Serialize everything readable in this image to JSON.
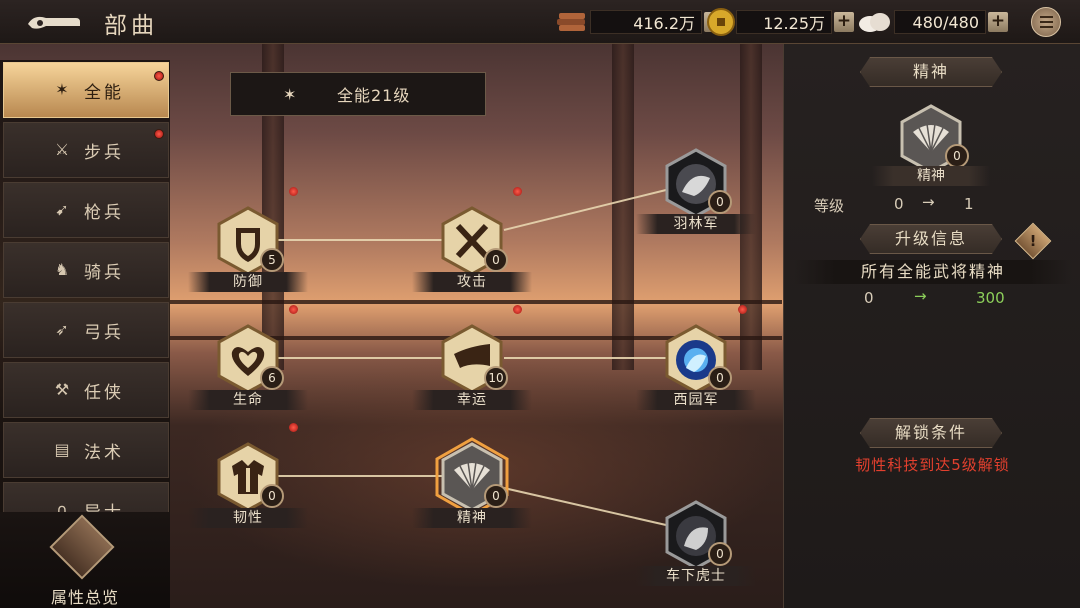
{
  "header": {
    "title": "部曲",
    "resources": [
      {
        "name": "supplies",
        "icon": "scroll-stack-icon",
        "value": "416.2万"
      },
      {
        "name": "coins",
        "icon": "gold-coin-icon",
        "value": "12.25万"
      },
      {
        "name": "stamina",
        "icon": "cloud-bun-icon",
        "value": "480/480"
      }
    ],
    "plus_label": "+"
  },
  "sidebar": {
    "tabs": [
      {
        "label": "全能",
        "icon": "all-round-icon",
        "active": true,
        "red_dot": true
      },
      {
        "label": "步兵",
        "icon": "sword-icon",
        "active": false,
        "red_dot": true
      },
      {
        "label": "枪兵",
        "icon": "spear-icon",
        "active": false,
        "red_dot": false
      },
      {
        "label": "骑兵",
        "icon": "horse-icon",
        "active": false,
        "red_dot": false
      },
      {
        "label": "弓兵",
        "icon": "bow-icon",
        "active": false,
        "red_dot": false
      },
      {
        "label": "任侠",
        "icon": "axe-icon",
        "active": false,
        "red_dot": false
      },
      {
        "label": "法术",
        "icon": "book-icon",
        "active": false,
        "red_dot": false
      },
      {
        "label": "异士",
        "icon": "magnet-icon",
        "active": false,
        "red_dot": false
      }
    ],
    "overview_label": "属性总览"
  },
  "level_banner": {
    "text": "全能21级"
  },
  "tree": {
    "nodes": [
      {
        "id": "defense",
        "label": "防御",
        "count": "5",
        "icon": "shield-icon"
      },
      {
        "id": "attack",
        "label": "攻击",
        "count": "0",
        "icon": "crossed-swords-icon"
      },
      {
        "id": "yulin",
        "label": "羽林军",
        "count": "0",
        "icon": "general-portrait-icon"
      },
      {
        "id": "life",
        "label": "生命",
        "count": "6",
        "icon": "heart-icon"
      },
      {
        "id": "luck",
        "label": "幸运",
        "count": "10",
        "icon": "horn-icon"
      },
      {
        "id": "xiyuan",
        "label": "西园军",
        "count": "0",
        "icon": "general-portrait-icon"
      },
      {
        "id": "toughness",
        "label": "韧性",
        "count": "0",
        "icon": "armor-icon"
      },
      {
        "id": "spirit",
        "label": "精神",
        "count": "0",
        "icon": "fan-icon",
        "selected": true
      },
      {
        "id": "chexia",
        "label": "车下虎士",
        "count": "0",
        "icon": "general-portrait-icon"
      }
    ]
  },
  "panel": {
    "header": "精神",
    "skill_name": "精神",
    "skill_count": "0",
    "level_label": "等级",
    "level_from": "0",
    "level_to": "1",
    "arrow": "→",
    "upgrade_header": "升级信息",
    "warn_symbol": "!",
    "stat_desc": "所有全能武将精神",
    "stat_from": "0",
    "stat_to": "300",
    "unlock_header": "解锁条件",
    "unlock_text": "韧性科技到达5级解锁"
  },
  "colors": {
    "accent_gold": "#e8c890",
    "panel_bg": "#262120",
    "unlock_red": "#e2402e",
    "stat_green": "#8ccf5a"
  }
}
